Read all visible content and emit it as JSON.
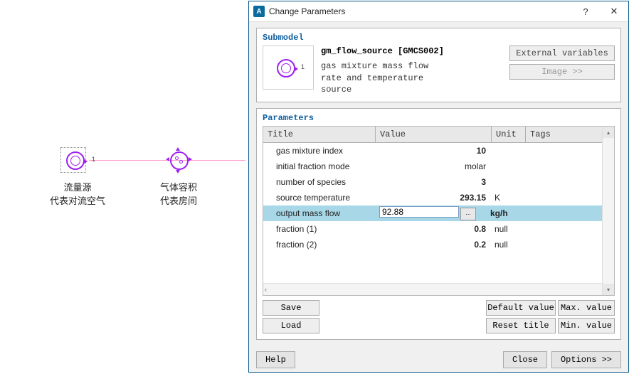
{
  "canvas": {
    "node1_port": "1",
    "node1_label1": "流量源",
    "node1_label2": "代表对流空气",
    "node2_label1": "气体容积",
    "node2_label2": "代表房间"
  },
  "dialog": {
    "title": "Change Parameters",
    "help_glyph": "?",
    "close_glyph": "✕"
  },
  "submodel": {
    "section_label": "Submodel",
    "title": "gm_flow_source [GMCS002]",
    "desc": "gas mixture mass flow rate and temperature source",
    "thumb_port": "1",
    "btn_ext": "External variables",
    "btn_img": "Image >>"
  },
  "params": {
    "section_label": "Parameters",
    "head_title": "Title",
    "head_value": "Value",
    "head_unit": "Unit",
    "head_tags": "Tags",
    "rows": [
      {
        "title": "gas mixture index",
        "value": "10",
        "unit": ""
      },
      {
        "title": "initial fraction mode",
        "value": "molar",
        "unit": ""
      },
      {
        "title": "number of species",
        "value": "3",
        "unit": ""
      },
      {
        "title": "source temperature",
        "value": "293.15",
        "unit": "K"
      },
      {
        "title": "output mass flow",
        "value": "92.88",
        "unit": "kg/h",
        "selected": true
      },
      {
        "title": "fraction (1)",
        "value": "0.8",
        "unit": "null"
      },
      {
        "title": "fraction (2)",
        "value": "0.2",
        "unit": "null"
      }
    ],
    "value_more": "...",
    "btn_save": "Save",
    "btn_load": "Load",
    "btn_default": "Default value",
    "btn_max": "Max. value",
    "btn_reset": "Reset title",
    "btn_min": "Min. value"
  },
  "footer": {
    "help": "Help",
    "close": "Close",
    "options": "Options >>"
  },
  "scroll": {
    "left": "‹",
    "right": "›",
    "up": "▴",
    "down": "▾"
  }
}
